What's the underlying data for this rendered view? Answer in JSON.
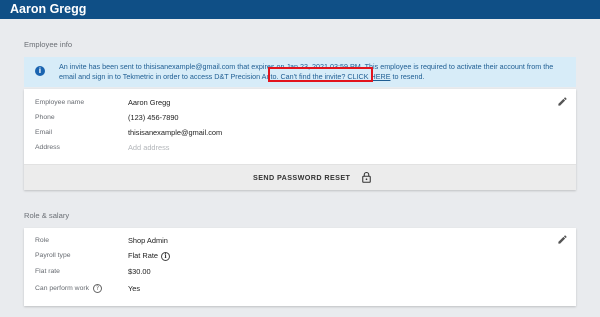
{
  "header": {
    "title": "Aaron Gregg"
  },
  "employee_info": {
    "section_label": "Employee info",
    "banner": {
      "text_before": "An invite has been sent to thisisanexample@gmail.com that expires on Jan 23, 2021 03:59 PM. This employee is required to activate their account from the email and sign in to Tekmetric in order to access D&T Precision Auto. Can't find the invite? ",
      "link_text": "CLICK HERE",
      "text_after": " to resend."
    },
    "fields": [
      {
        "label": "Employee name",
        "value": "Aaron Gregg"
      },
      {
        "label": "Phone",
        "value": "(123) 456-7890"
      },
      {
        "label": "Email",
        "value": "thisisanexample@gmail.com"
      },
      {
        "label": "Address",
        "placeholder": "Add address"
      }
    ],
    "reset_button": "SEND PASSWORD RESET"
  },
  "role_salary": {
    "section_label": "Role & salary",
    "fields": [
      {
        "label": "Role",
        "value": "Shop Admin"
      },
      {
        "label": "Payroll type",
        "value": "Flat Rate"
      },
      {
        "label": "Flat rate",
        "value": "$30.00"
      },
      {
        "label": "Can perform work",
        "value": "Yes"
      }
    ]
  },
  "icons": {
    "info": "info-circle-icon",
    "edit": "pencil-icon",
    "lock": "lock-icon",
    "help": "question-circle-icon"
  },
  "colors": {
    "header": "#0f4f86",
    "banner_bg": "#d7ecf8",
    "banner_text": "#1f5e93",
    "highlight": "#e2141d"
  }
}
